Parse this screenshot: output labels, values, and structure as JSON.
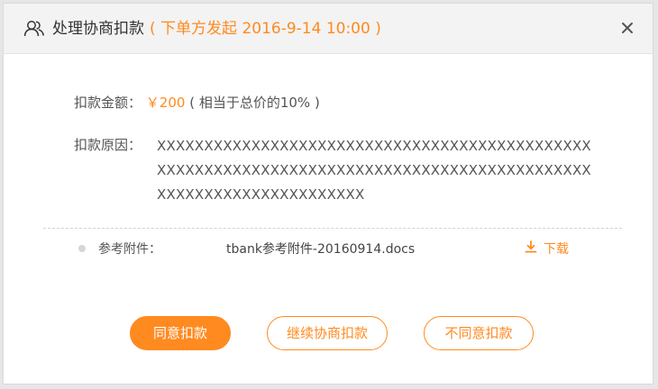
{
  "header": {
    "title": "处理协商扣款",
    "subtitle": "( 下单方发起  2016-9-14  10:00 )",
    "icon": "users-icon",
    "close_icon": "close-icon"
  },
  "amount": {
    "label": "扣款金额：",
    "value": "￥200",
    "note": "( 相当于总价的10% )"
  },
  "reason": {
    "label": "扣款原因：",
    "text": "XXXXXXXXXXXXXXXXXXXXXXXXXXXXXXXXXXXXXXXXXXXXXXXXXXXXXXXXXXXXXXXXXXXXXXXXXXXXXXXXXXXXXXXXXXXXXXXXXXXXXXXXXXXXXXXXXX"
  },
  "attachment": {
    "label": "参考附件：",
    "filename": "tbank参考附件-20160914.docs",
    "download_label": "下载",
    "download_icon": "download-icon"
  },
  "buttons": {
    "agree": "同意扣款",
    "continue": "继续协商扣款",
    "disagree": "不同意扣款"
  },
  "colors": {
    "accent": "#ff8a20",
    "text": "#555555",
    "header_bg": "#f3f3f3"
  }
}
